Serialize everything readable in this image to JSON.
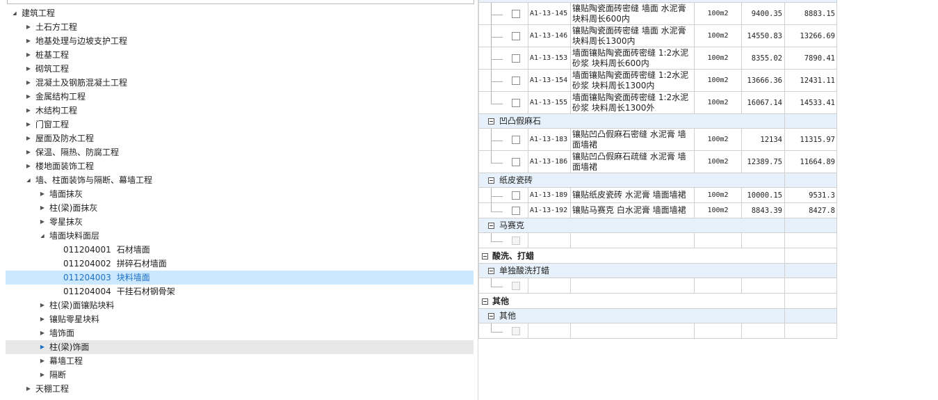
{
  "tree": [
    {
      "label": "建筑工程",
      "level": 0,
      "state": "open"
    },
    {
      "label": "土石方工程",
      "level": 1,
      "state": "closed"
    },
    {
      "label": "地基处理与边坡支护工程",
      "level": 1,
      "state": "closed"
    },
    {
      "label": "桩基工程",
      "level": 1,
      "state": "closed"
    },
    {
      "label": "砌筑工程",
      "level": 1,
      "state": "closed"
    },
    {
      "label": "混凝土及钢筋混凝土工程",
      "level": 1,
      "state": "closed"
    },
    {
      "label": "金属结构工程",
      "level": 1,
      "state": "closed"
    },
    {
      "label": "木结构工程",
      "level": 1,
      "state": "closed"
    },
    {
      "label": "门窗工程",
      "level": 1,
      "state": "closed"
    },
    {
      "label": "屋面及防水工程",
      "level": 1,
      "state": "closed"
    },
    {
      "label": "保温、隔热、防腐工程",
      "level": 1,
      "state": "closed"
    },
    {
      "label": "楼地面装饰工程",
      "level": 1,
      "state": "closed"
    },
    {
      "label": "墙、柱面装饰与隔断、幕墙工程",
      "level": 1,
      "state": "open"
    },
    {
      "label": "墙面抹灰",
      "level": 2,
      "state": "closed"
    },
    {
      "label": "柱(梁)面抹灰",
      "level": 2,
      "state": "closed"
    },
    {
      "label": "零星抹灰",
      "level": 2,
      "state": "closed"
    },
    {
      "label": "墙面块料面层",
      "level": 2,
      "state": "open"
    },
    {
      "code": "011204001",
      "label": "石材墙面",
      "level": 3,
      "state": "leaf"
    },
    {
      "code": "011204002",
      "label": "拼碎石材墙面",
      "level": 3,
      "state": "leaf"
    },
    {
      "code": "011204003",
      "label": "块料墙面",
      "level": 3,
      "state": "leaf",
      "selected": true
    },
    {
      "code": "011204004",
      "label": "干挂石材钢骨架",
      "level": 3,
      "state": "leaf"
    },
    {
      "label": "柱(梁)面镶贴块料",
      "level": 2,
      "state": "closed"
    },
    {
      "label": "镶贴零星块料",
      "level": 2,
      "state": "closed"
    },
    {
      "label": "墙饰面",
      "level": 2,
      "state": "closed"
    },
    {
      "label": "柱(梁)饰面",
      "level": 2,
      "state": "closed",
      "hover": true
    },
    {
      "label": "幕墙工程",
      "level": 2,
      "state": "closed"
    },
    {
      "label": "隔断",
      "level": 2,
      "state": "closed"
    },
    {
      "label": "天棚工程",
      "level": 1,
      "state": "closed"
    }
  ],
  "grid": [
    {
      "type": "item",
      "h": 33,
      "code": "A1-13-145",
      "name": "镶贴陶瓷面砖密缝 墙面 水泥膏 块料周长600内",
      "unit": "100m2",
      "p1": "9400.35",
      "p2": "8883.15"
    },
    {
      "type": "item",
      "h": 33,
      "code": "A1-13-146",
      "name": "镶贴陶瓷面砖密缝 墙面 水泥膏 块料周长1300内",
      "unit": "100m2",
      "p1": "14550.83",
      "p2": "13266.69"
    },
    {
      "type": "item",
      "h": 33,
      "code": "A1-13-153",
      "name": "墙面镶贴陶瓷面砖密缝 1:2水泥砂浆 块料周长600内",
      "unit": "100m2",
      "p1": "8355.02",
      "p2": "7890.41"
    },
    {
      "type": "item",
      "h": 33,
      "code": "A1-13-154",
      "name": "墙面镶贴陶瓷面砖密缝 1:2水泥砂浆 块料周长1300内",
      "unit": "100m2",
      "p1": "13666.36",
      "p2": "12431.11"
    },
    {
      "type": "item",
      "h": 33,
      "code": "A1-13-155",
      "name": "墙面镶贴陶瓷面砖密缝 1:2水泥砂浆 块料周长1300外",
      "unit": "100m2",
      "p1": "16067.14",
      "p2": "14533.41",
      "last": true
    },
    {
      "type": "group2",
      "h": 22,
      "label": "凹凸假麻石"
    },
    {
      "type": "item",
      "h": 33,
      "code": "A1-13-183",
      "name": "镶贴凹凸假麻石密缝 水泥膏 墙面墙裙",
      "unit": "100m2",
      "p1": "12134",
      "p2": "11315.97"
    },
    {
      "type": "item",
      "h": 33,
      "code": "A1-13-186",
      "name": "镶贴凹凸假麻石疏缝 水泥膏 墙面墙裙",
      "unit": "100m2",
      "p1": "12389.75",
      "p2": "11664.89",
      "last": true
    },
    {
      "type": "group2",
      "h": 22,
      "label": "纸皮瓷砖"
    },
    {
      "type": "item",
      "h": 23,
      "code": "A1-13-189",
      "name": "镶贴纸皮瓷砖 水泥膏 墙面墙裙",
      "unit": "100m2",
      "p1": "10000.15",
      "p2": "9531.3"
    },
    {
      "type": "item",
      "h": 23,
      "code": "A1-13-192",
      "name": "镶贴马赛克 白水泥膏 墙面墙裙",
      "unit": "100m2",
      "p1": "8843.39",
      "p2": "8427.8",
      "last": true
    },
    {
      "type": "group2",
      "h": 22,
      "label": "马赛克"
    },
    {
      "type": "empty",
      "h": 23
    },
    {
      "type": "group1",
      "h": 23,
      "label": "酸洗、打蜡"
    },
    {
      "type": "group2",
      "h": 22,
      "label": "单独酸洗打蜡"
    },
    {
      "type": "empty",
      "h": 23
    },
    {
      "type": "group1",
      "h": 23,
      "label": "其他"
    },
    {
      "type": "group2",
      "h": 22,
      "label": "其他"
    },
    {
      "type": "empty",
      "h": 23
    }
  ]
}
